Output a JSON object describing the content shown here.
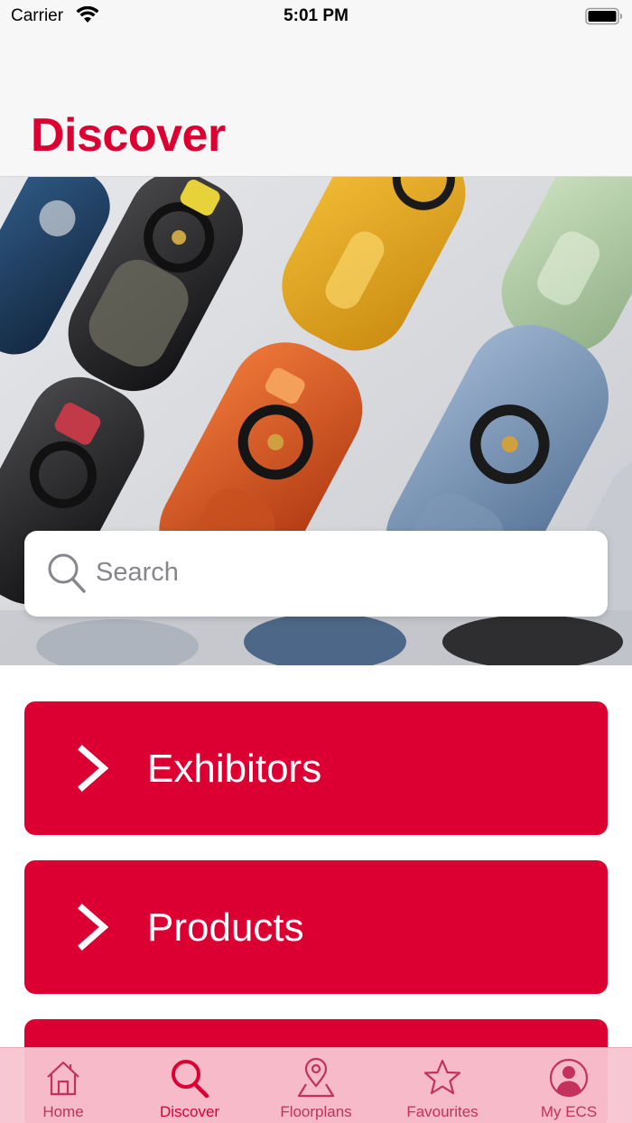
{
  "status_bar": {
    "carrier": "Carrier",
    "time": "5:01 PM"
  },
  "header": {
    "title": "Discover"
  },
  "search": {
    "placeholder": "Search"
  },
  "menu": {
    "items": [
      {
        "label": "Exhibitors",
        "icon": "chevron-right-icon"
      },
      {
        "label": "Products",
        "icon": "chevron-right-icon"
      },
      {
        "label": ""
      }
    ]
  },
  "tab_bar": {
    "tabs": [
      {
        "label": "Home",
        "icon": "house-icon",
        "selected": false
      },
      {
        "label": "Discover",
        "icon": "magnifier-icon",
        "selected": true
      },
      {
        "label": "Floorplans",
        "icon": "map-pin-icon",
        "selected": false
      },
      {
        "label": "Favourites",
        "icon": "star-icon",
        "selected": false
      },
      {
        "label": "My ECS",
        "icon": "person-circle-icon",
        "selected": false
      }
    ]
  },
  "colors": {
    "accent": "#dc0032",
    "tab_bar_background": "#f7c4d2",
    "header_background": "#f7f7f7"
  }
}
